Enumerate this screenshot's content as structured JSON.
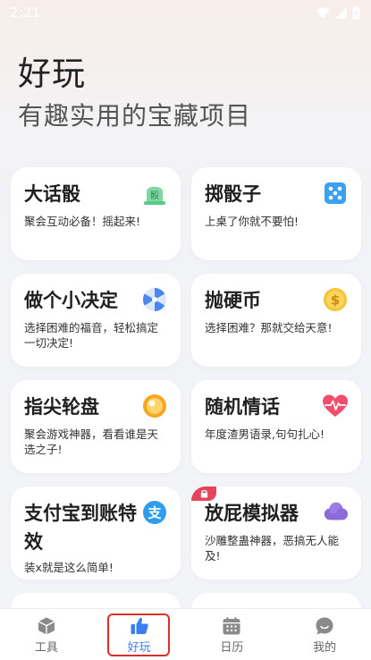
{
  "status_bar": {
    "time": "2:21",
    "icons": [
      "wifi-icon",
      "cellular-icon",
      "battery-icon"
    ]
  },
  "header": {
    "title": "好玩",
    "subtitle": "有趣实用的宝藏项目"
  },
  "cards": [
    {
      "title": "大话骰",
      "desc": "聚会互动必备！摇起来!",
      "icon": "dice-cup-icon",
      "icon_text": "骰",
      "icon_color": "#5bc98a"
    },
    {
      "title": "掷骰子",
      "desc": "上桌了你就不要怕!",
      "icon": "dice-icon",
      "icon_color": "#3aa0f0"
    },
    {
      "title": "做个小决定",
      "desc": "选择困难的福音，轻松搞定一切决定!",
      "icon": "spinner-icon",
      "icon_color": "#4a86f0"
    },
    {
      "title": "抛硬币",
      "desc": "选择困难？那就交给天意!",
      "icon": "coin-icon",
      "icon_text": "$",
      "icon_color": "#f7c23a"
    },
    {
      "title": "指尖轮盘",
      "desc": "聚会游戏神器，看看谁是天选之子!",
      "icon": "roulette-ball-icon",
      "icon_color": "#f5a623"
    },
    {
      "title": "随机情话",
      "desc": "年度渣男语录,句句扎心!",
      "icon": "heartbeat-icon",
      "icon_color": "#f04e6a"
    },
    {
      "title": "支付宝到账特效",
      "desc": "装x就是这么简单!",
      "icon": "alipay-icon",
      "icon_text": "支",
      "icon_color": "#2f9cf0"
    },
    {
      "title": "放屁模拟器",
      "desc": "沙雕整蛊神器，恶搞无人能及!",
      "icon": "cloud-icon",
      "icon_color": "#8b6bd8",
      "locked": true
    }
  ],
  "bottom_nav": {
    "items": [
      {
        "label": "工具",
        "icon": "cube-icon"
      },
      {
        "label": "好玩",
        "icon": "thumbs-up-icon",
        "active": true
      },
      {
        "label": "日历",
        "icon": "calendar-icon"
      },
      {
        "label": "我的",
        "icon": "chat-smile-icon"
      }
    ]
  },
  "colors": {
    "accent": "#3d7df3",
    "highlight": "#d9302b"
  }
}
